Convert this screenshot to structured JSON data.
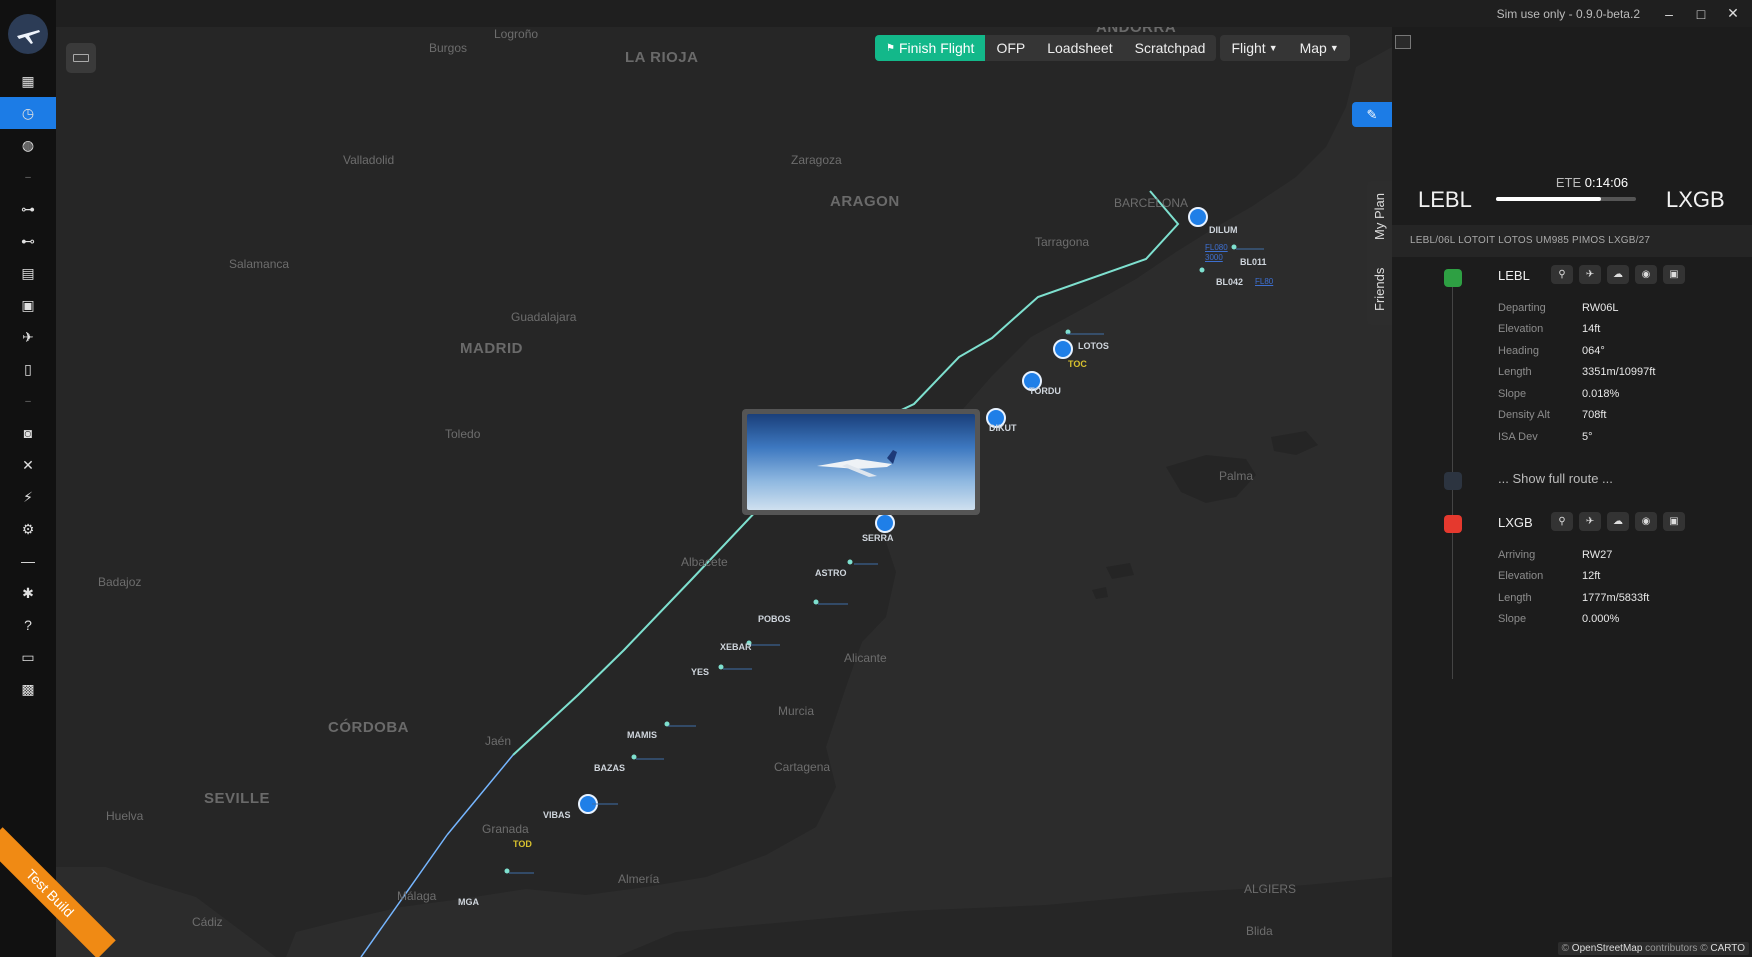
{
  "titlebar": {
    "version": "Sim use only - 0.9.0-beta.2"
  },
  "sidebar": {
    "icons": [
      "dashboard-icon",
      "clock-icon",
      "globe-icon",
      "separator",
      "route-icon",
      "route-alt-icon",
      "calendar-icon",
      "documents-icon",
      "plane-icon",
      "file-icon",
      "separator",
      "cargo-icon",
      "tools-icon",
      "plug-icon",
      "gear-icon",
      "minus-icon",
      "bug-icon",
      "help-icon",
      "discord-icon",
      "gift-icon"
    ]
  },
  "toolbar": {
    "finish_flight": "Finish Flight",
    "ofp": "OFP",
    "loadsheet": "Loadsheet",
    "scratchpad": "Scratchpad",
    "flight": "Flight",
    "map": "Map"
  },
  "side_tabs": {
    "my_plan": "My Plan",
    "friends": "Friends"
  },
  "map": {
    "regions": [
      "LA RIOJA",
      "ARAGON",
      "MADRID",
      "ANDORRA",
      "CÓRDOBA",
      "SEVILLE"
    ],
    "cities": [
      "Logroño",
      "Burgos",
      "Valladolid",
      "Zaragoza",
      "Salamanca",
      "Guadalajara",
      "Tarragona",
      "Barcelona",
      "Toledo",
      "Albacete",
      "Badajoz",
      "Huelva",
      "Jaén",
      "Granada",
      "Málaga",
      "Cádiz",
      "Almería",
      "Cartagena",
      "Murcia",
      "Alicante",
      "Palma",
      "Algiers",
      "Blida"
    ],
    "city_labels": {
      "logrono": "Logroño",
      "burgos": "Burgos",
      "la_rioja": "LA RIOJA",
      "valladolid": "Valladolid",
      "zaragoza": "Zaragoza",
      "aragon": "ARAGON",
      "barcelona": "BARCELONA",
      "tarragona": "Tarragona",
      "salamanca": "Salamanca",
      "guadalajara": "Guadalajara",
      "madrid": "MADRID",
      "toledo": "Toledo",
      "albacete": "Albacete",
      "badajoz": "Badajoz",
      "alicante": "Alicante",
      "murcia": "Murcia",
      "cordoba": "CÓRDOBA",
      "jaen": "Jaén",
      "cartagena": "Cartagena",
      "seville": "SEVILLE",
      "huelva": "Huelva",
      "granada": "Granada",
      "almeria": "Almería",
      "malaga": "Málaga",
      "cadiz": "Cádiz",
      "palma": "Palma",
      "algiers": "ALGIERS",
      "blida": "Blida",
      "andorra": "ANDORRA"
    },
    "waypoints": {
      "bl011": "BL011",
      "bl042": "BL042",
      "dilum": "DILUM",
      "lotos": "LOTOS",
      "toc": "TOC",
      "tordu": "TORDU",
      "dikut": "DIKUT",
      "serra": "SERRA",
      "astro": "ASTRO",
      "pobos": "POBOS",
      "xebar": "XEBAR",
      "yes": "YES",
      "mamis": "MAMIS",
      "bazas": "BAZAS",
      "vibas": "VIBAS",
      "tod": "TOD",
      "mga": "MGA",
      "fl080": "FL080",
      "fl80b": "FL80",
      "alt": "3000"
    }
  },
  "panel": {
    "departure_icao": "LEBL",
    "arrival_icao": "LXGB",
    "ete_label": "ETE",
    "ete_value": "0:14:06",
    "progress": 0.75,
    "route": "LEBL/06L LOTOIT LOTOS UM985 PIMOS LXGB/27",
    "show_full_route": "... Show full route ...",
    "departure": {
      "code": "LEBL",
      "rows": [
        {
          "k": "Departing",
          "v": "RW06L"
        },
        {
          "k": "Elevation",
          "v": "14ft"
        },
        {
          "k": "Heading",
          "v": "064°"
        },
        {
          "k": "Length",
          "v": "3351m/10997ft"
        },
        {
          "k": "Slope",
          "v": "0.018%"
        },
        {
          "k": "Density Alt",
          "v": "708ft"
        },
        {
          "k": "ISA Dev",
          "v": "5°"
        }
      ]
    },
    "arrival": {
      "code": "LXGB",
      "rows": [
        {
          "k": "Arriving",
          "v": "RW27"
        },
        {
          "k": "Elevation",
          "v": "12ft"
        },
        {
          "k": "Length",
          "v": "1777m/5833ft"
        },
        {
          "k": "Slope",
          "v": "0.000%"
        }
      ]
    },
    "status_colors": {
      "departure": "#2ea043",
      "pending": "#2c3440",
      "arrival": "#e5392e"
    }
  },
  "attribution": {
    "prefix": "© ",
    "osm": "OpenStreetMap",
    "mid": " contributors © ",
    "carto": "CARTO"
  },
  "ribbon": "Test Build",
  "colors": {
    "accent": "#1c7ce6",
    "route": "#7ee0cf",
    "finish": "#13b88a"
  }
}
